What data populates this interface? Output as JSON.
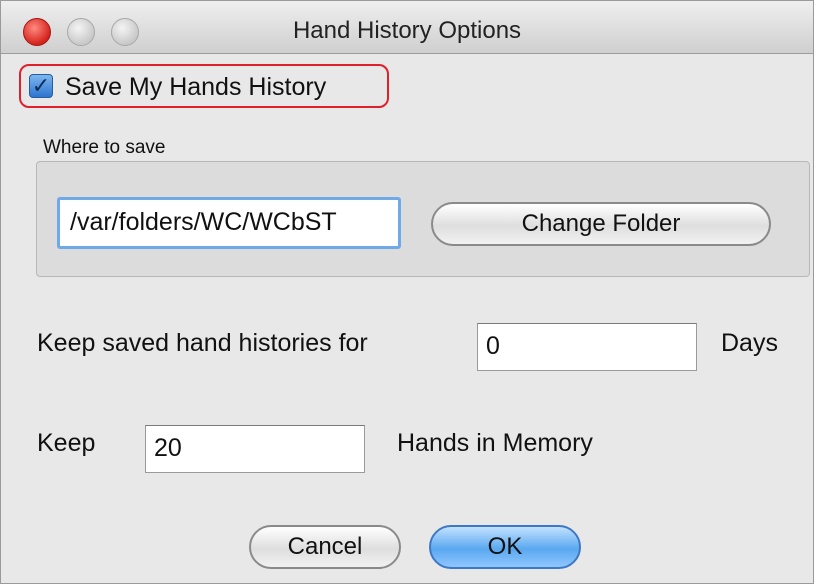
{
  "window": {
    "title": "Hand History Options"
  },
  "save_history": {
    "label": "Save My Hands History",
    "checked": true
  },
  "where_to_save": {
    "label": "Where to save",
    "path_value": "/var/folders/WC/WCbST",
    "change_folder_label": "Change Folder"
  },
  "keep_days": {
    "label": "Keep saved hand histories for",
    "value": "0",
    "unit": "Days"
  },
  "keep_hands": {
    "label": "Keep",
    "value": "20",
    "unit": "Hands in Memory"
  },
  "buttons": {
    "cancel": "Cancel",
    "ok": "OK"
  },
  "colors": {
    "highlight": "#e0202a",
    "accent": "#5aa8f0"
  }
}
